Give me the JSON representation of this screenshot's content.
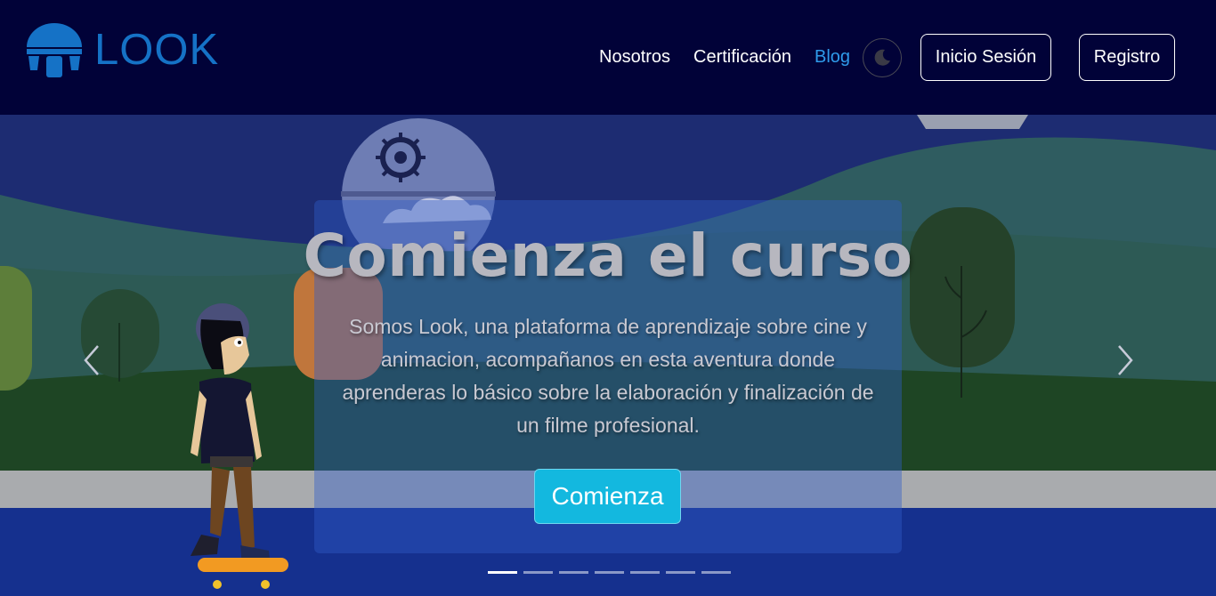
{
  "brand": {
    "name": "LOOK",
    "color": "#1572c6"
  },
  "nav": {
    "links": [
      {
        "label": "Nosotros"
      },
      {
        "label": "Certificación"
      },
      {
        "label": "Blog",
        "active": true
      }
    ],
    "theme_icon": "moon-icon",
    "login_label": "Inicio Sesión",
    "register_label": "Registro"
  },
  "hero": {
    "title": "Comienza el curso",
    "text": "Somos Look, una plataforma de aprendizaje sobre cine y animacion, acompañanos en esta aventura donde aprenderas lo básico sobre la elaboración y finalización de un filme profesional.",
    "cta_label": "Comienza",
    "prev_icon": "chevron-left-icon",
    "next_icon": "chevron-right-icon",
    "slide_count": 7,
    "active_slide": 1
  },
  "colors": {
    "navbar_bg": "#010238",
    "active_link": "#2f9bea",
    "cta_bg": "#13b8df"
  }
}
